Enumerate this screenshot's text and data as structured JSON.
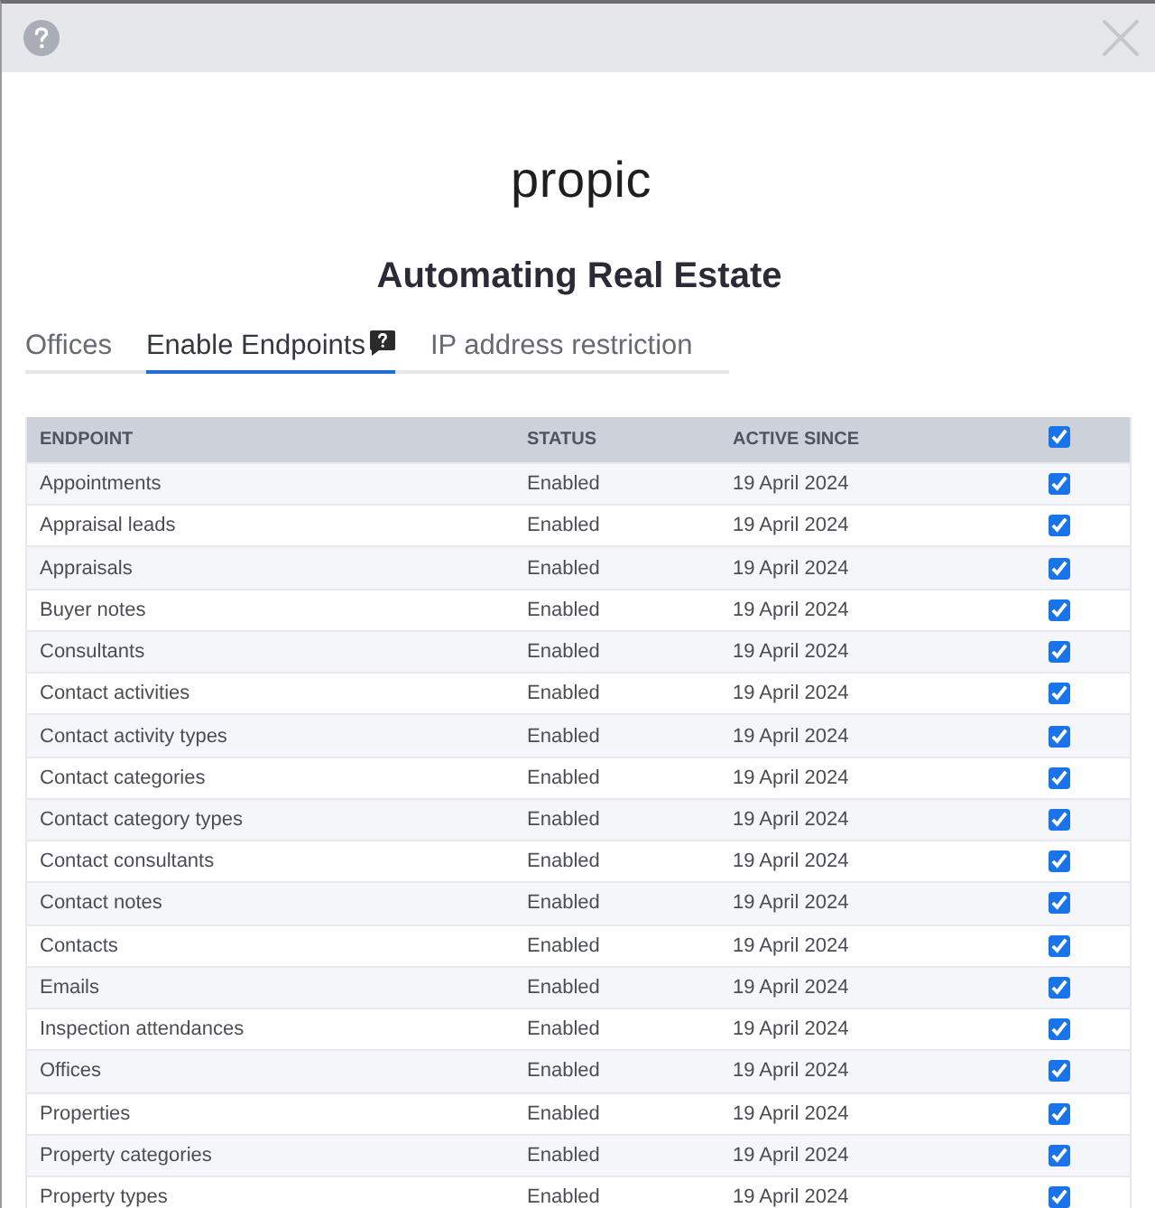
{
  "logo": "propic",
  "title": "Automating Real Estate",
  "tabs": [
    {
      "label": "Offices",
      "selected": false,
      "help": false
    },
    {
      "label": "Enable Endpoints",
      "selected": true,
      "help": true
    },
    {
      "label": "IP address restriction",
      "selected": false,
      "help": false
    }
  ],
  "table": {
    "columns": [
      "ENDPOINT",
      "STATUS",
      "ACTIVE SINCE"
    ],
    "select_all": {
      "checked": true
    },
    "rows": [
      {
        "endpoint": "Appointments",
        "status": "Enabled",
        "active_since": "19 April 2024",
        "checked": true
      },
      {
        "endpoint": "Appraisal leads",
        "status": "Enabled",
        "active_since": "19 April 2024",
        "checked": true
      },
      {
        "endpoint": "Appraisals",
        "status": "Enabled",
        "active_since": "19 April 2024",
        "checked": true
      },
      {
        "endpoint": "Buyer notes",
        "status": "Enabled",
        "active_since": "19 April 2024",
        "checked": true
      },
      {
        "endpoint": "Consultants",
        "status": "Enabled",
        "active_since": "19 April 2024",
        "checked": true
      },
      {
        "endpoint": "Contact activities",
        "status": "Enabled",
        "active_since": "19 April 2024",
        "checked": true
      },
      {
        "endpoint": "Contact activity types",
        "status": "Enabled",
        "active_since": "19 April 2024",
        "checked": true
      },
      {
        "endpoint": "Contact categories",
        "status": "Enabled",
        "active_since": "19 April 2024",
        "checked": true
      },
      {
        "endpoint": "Contact category types",
        "status": "Enabled",
        "active_since": "19 April 2024",
        "checked": true
      },
      {
        "endpoint": "Contact consultants",
        "status": "Enabled",
        "active_since": "19 April 2024",
        "checked": true
      },
      {
        "endpoint": "Contact notes",
        "status": "Enabled",
        "active_since": "19 April 2024",
        "checked": true
      },
      {
        "endpoint": "Contacts",
        "status": "Enabled",
        "active_since": "19 April 2024",
        "checked": true
      },
      {
        "endpoint": "Emails",
        "status": "Enabled",
        "active_since": "19 April 2024",
        "checked": true
      },
      {
        "endpoint": "Inspection attendances",
        "status": "Enabled",
        "active_since": "19 April 2024",
        "checked": true
      },
      {
        "endpoint": "Offices",
        "status": "Enabled",
        "active_since": "19 April 2024",
        "checked": true
      },
      {
        "endpoint": "Properties",
        "status": "Enabled",
        "active_since": "19 April 2024",
        "checked": true
      },
      {
        "endpoint": "Property categories",
        "status": "Enabled",
        "active_since": "19 April 2024",
        "checked": true
      },
      {
        "endpoint": "Property types",
        "status": "Enabled",
        "active_since": "19 April 2024",
        "checked": true
      }
    ]
  }
}
